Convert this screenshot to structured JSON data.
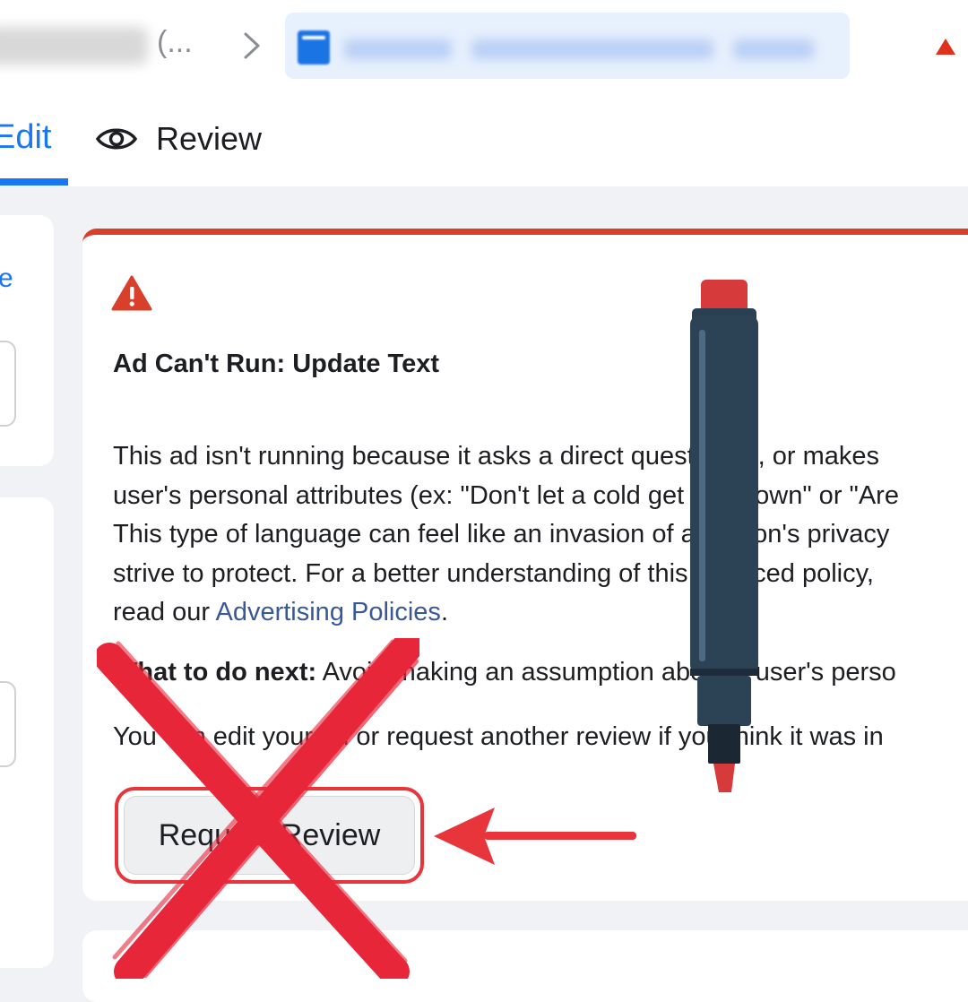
{
  "header": {
    "breadcrumb_ellipsis": "(...",
    "warning_icon": "warning-triangle-icon"
  },
  "tabs": {
    "edit_label": "Edit",
    "review_label": "Review",
    "review_icon": "eye-icon"
  },
  "sidebar": {
    "link_fragment": "e"
  },
  "alert": {
    "icon": "warning-triangle-icon",
    "accent_color": "#d8402b",
    "title": "Ad Can't Run: Update Text",
    "body_lines": [
      "This ad isn't running because it asks a direct question to, or makes",
      "user's personal attributes (ex: \"Don't let a cold get you down\" or \"Are",
      "This type of language can feel like an invasion of a person's privacy",
      "strive to protect. For a better understanding of this nuanced policy,"
    ],
    "read_prefix": "read our ",
    "policy_link": "Advertising Policies",
    "read_suffix": ".",
    "next_label": "What to do next:",
    "next_text": " Avoid making an assumption about a user's perso",
    "edit_text": "You can edit your ad or request another review if you think it was in",
    "request_button": "Request Review"
  },
  "overlays": {
    "highlight_color": "#e8353b",
    "arrow": "red-arrow",
    "cross": "red-x-mark",
    "marker": "red-marker"
  }
}
